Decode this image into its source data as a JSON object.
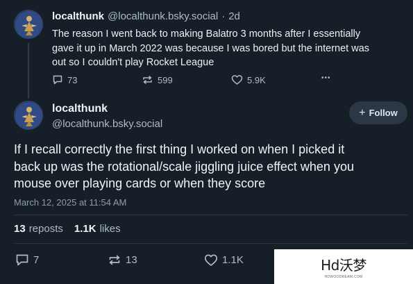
{
  "parent_post": {
    "display_name": "localthunk",
    "handle": "@localthunk.bsky.social",
    "separator": "·",
    "time_ago": "2d",
    "text_lines": [
      "The reason I went back to making Balatro 3 months after I essentially",
      "gave it up in March 2022 was because I was bored but the internet was",
      "out so I couldn't play Rocket League"
    ],
    "replies": "73",
    "reposts": "599",
    "likes": "5.9K",
    "more": "•••"
  },
  "main_post": {
    "display_name": "localthunk",
    "handle": "@localthunk.bsky.social",
    "follow_plus": "+",
    "follow_label": "Follow",
    "text_lines": [
      "If I recall correctly the first thing I worked on when I picked it",
      "back up was the rotational/scale jiggling juice effect when you",
      "mouse over playing cards or when they score"
    ],
    "timestamp": "March 12, 2025 at 11:54 AM",
    "repost_count": "13",
    "repost_label": "reposts",
    "like_count": "1.1K",
    "like_label": "likes",
    "replies": "7",
    "reposts": "13",
    "likes": "1.1K"
  },
  "watermark": {
    "main": "Hd沃梦",
    "sub": "HDWOODREAM.COM"
  },
  "colors": {
    "background": "#161e27",
    "text": "#f1f3f5",
    "muted": "#aebbc9",
    "divider": "#2c3846",
    "follow_bg": "#2b3745"
  },
  "icons": [
    "reply-icon",
    "repost-icon",
    "heart-icon",
    "more-icon",
    "avatar-image"
  ]
}
